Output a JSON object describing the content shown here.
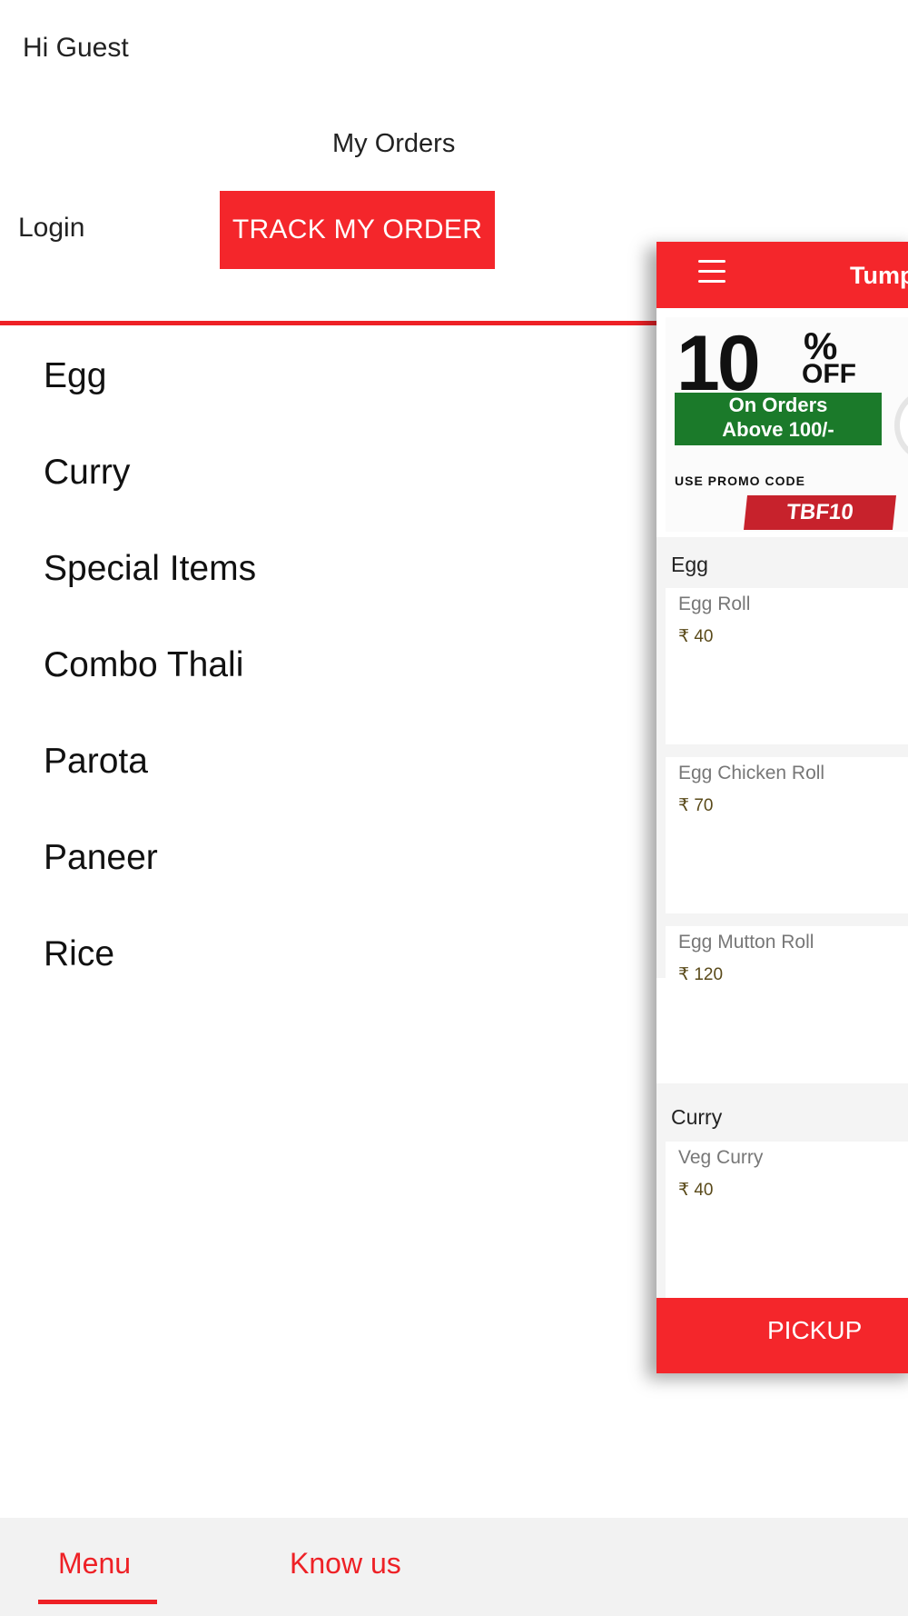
{
  "header": {
    "greeting": "Hi Guest",
    "my_orders": "My Orders",
    "login": "Login",
    "track_button": "TRACK MY ORDER"
  },
  "categories": [
    "Egg",
    "Curry",
    "Special Items",
    "Combo Thali",
    "Parota",
    "Paneer",
    "Rice"
  ],
  "preview": {
    "title": "Tump",
    "banner": {
      "discount": "10",
      "percent": "%",
      "off": "OFF",
      "line1": "On Orders",
      "line2": "Above 100/-",
      "use_code": "USE PROMO CODE",
      "code": "TBF10"
    },
    "sections": [
      {
        "label": "Egg",
        "items": [
          {
            "name": "Egg Roll",
            "price": "₹ 40"
          },
          {
            "name": "Egg Chicken Roll",
            "price": "₹ 70"
          },
          {
            "name": "Egg Mutton Roll",
            "price": "₹ 120"
          }
        ]
      },
      {
        "label": "Curry",
        "items": [
          {
            "name": "Veg Curry",
            "price": "₹ 40"
          }
        ]
      }
    ],
    "pickup": "PICKUP"
  },
  "tabs": {
    "menu": "Menu",
    "know_us": "Know us"
  },
  "colors": {
    "accent": "#f4262b",
    "promo_green": "#1b7a2a",
    "promo_code_red": "#c7222c",
    "tabbar_bg": "#f2f2f2"
  }
}
